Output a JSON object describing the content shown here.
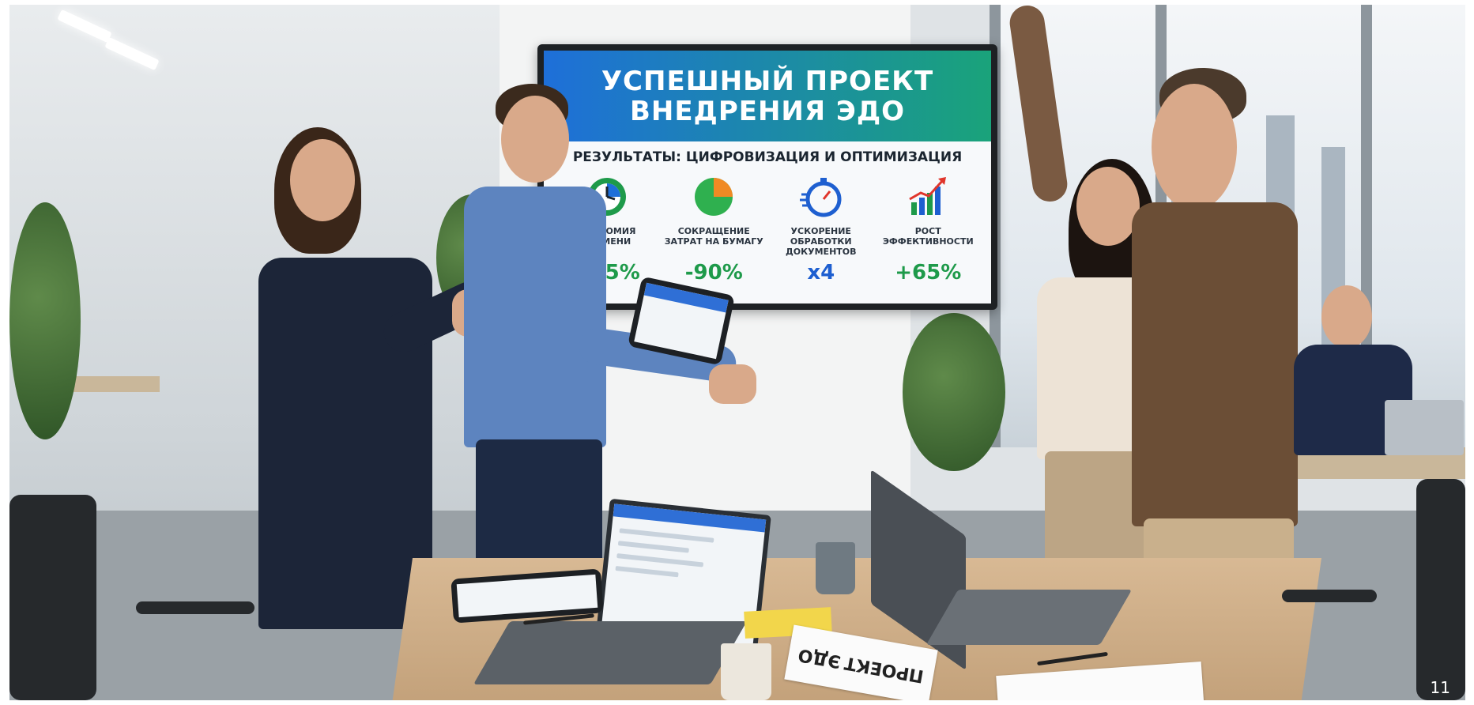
{
  "tv": {
    "title_line1": "УСПЕШНЫЙ ПРОЕКТ",
    "title_line2": "ВНЕДРЕНИЯ ЭДО",
    "subtitle": "РЕЗУЛЬТАТЫ: ЦИФРОВИЗАЦИЯ И ОПТИМИЗАЦИЯ",
    "metrics": [
      {
        "label_line1": "ЭКОНОМИЯ",
        "label_line2": "ВРЕМЕНИ",
        "label_line3": "",
        "value": "+75%",
        "icon": "clock-icon",
        "color": "#1e9a4a"
      },
      {
        "label_line1": "СОКРАЩЕНИЕ",
        "label_line2": "ЗАТРАТ НА БУМАГУ",
        "label_line3": "",
        "value": "-90%",
        "icon": "pie-chart-icon",
        "color": "#1e9a4a"
      },
      {
        "label_line1": "УСКОРЕНИЕ",
        "label_line2": "ОБРАБОТКИ",
        "label_line3": "ДОКУМЕНТОВ",
        "value": "x4",
        "icon": "stopwatch-icon",
        "color": "#1e5fd0"
      },
      {
        "label_line1": "РОСТ",
        "label_line2": "ЭФФЕКТИВНОСТИ",
        "label_line3": "",
        "value": "+65%",
        "icon": "growth-chart-icon",
        "color": "#1e9a4a"
      }
    ]
  },
  "desk_paper": {
    "line1": "ПРОЕКТ",
    "line2": "ЭДО"
  },
  "page_number": "11",
  "colors": {
    "banner_blue": "#1e6fd9",
    "banner_green": "#1aa37a",
    "accent_green": "#1e9a4a",
    "accent_blue": "#1e5fd0",
    "pie_orange": "#f08a24"
  }
}
